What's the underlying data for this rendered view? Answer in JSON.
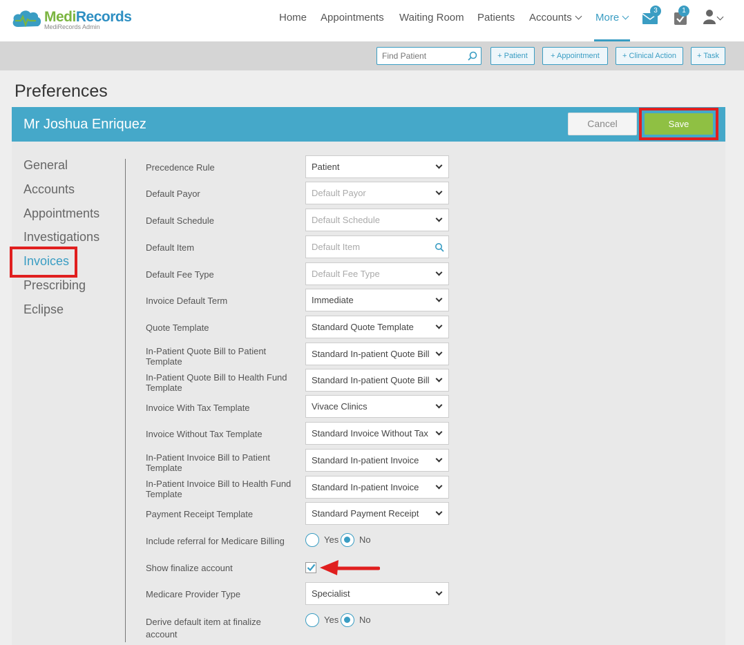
{
  "brand": {
    "name_part1": "Medi",
    "name_part2": "Records",
    "subtitle": "MediRecords Admin"
  },
  "nav": {
    "items": [
      {
        "label": "Home"
      },
      {
        "label": "Appointments"
      },
      {
        "label": "Waiting Room"
      },
      {
        "label": "Patients"
      },
      {
        "label": "Accounts"
      },
      {
        "label": "More"
      }
    ],
    "messages_count": "3",
    "tasks_count": "1"
  },
  "actionbar": {
    "find_placeholder": "Find Patient",
    "add_patient": "+ Patient",
    "add_appointment": "+ Appointment",
    "add_clinical_action": "+ Clinical Action",
    "add_task": "+ Task"
  },
  "page": {
    "title": "Preferences",
    "patient_name": "Mr Joshua Enriquez",
    "cancel_label": "Cancel",
    "save_label": "Save"
  },
  "sidebar": {
    "items": [
      {
        "label": "General"
      },
      {
        "label": "Accounts"
      },
      {
        "label": "Appointments"
      },
      {
        "label": "Investigations"
      },
      {
        "label": "Invoices"
      },
      {
        "label": "Prescribing"
      },
      {
        "label": "Eclipse"
      }
    ],
    "active": "Invoices"
  },
  "form": {
    "precedence_rule": {
      "label": "Precedence Rule",
      "value": "Patient"
    },
    "default_payor": {
      "label": "Default Payor",
      "placeholder": "Default Payor"
    },
    "default_schedule": {
      "label": "Default Schedule",
      "placeholder": "Default Schedule"
    },
    "default_item": {
      "label": "Default Item",
      "placeholder": "Default Item"
    },
    "default_fee_type": {
      "label": "Default Fee Type",
      "placeholder": "Default Fee Type"
    },
    "invoice_default_term": {
      "label": "Invoice Default Term",
      "value": "Immediate"
    },
    "quote_template": {
      "label": "Quote Template",
      "value": "Standard Quote Template"
    },
    "inpatient_quote_patient": {
      "label": "In-Patient Quote Bill to Patient Template",
      "value": "Standard In-patient Quote Bill"
    },
    "inpatient_quote_fund": {
      "label": "In-Patient Quote Bill to Health Fund Template",
      "value": "Standard In-patient Quote Bill"
    },
    "invoice_with_tax": {
      "label": "Invoice With Tax Template",
      "value": "Vivace Clinics"
    },
    "invoice_without_tax": {
      "label": "Invoice Without Tax Template",
      "value": "Standard Invoice Without Tax"
    },
    "inpatient_invoice_patient": {
      "label": "In-Patient Invoice Bill to Patient Template",
      "value": "Standard In-patient Invoice"
    },
    "inpatient_invoice_fund": {
      "label": "In-Patient Invoice Bill to Health Fund Template",
      "value": "Standard In-patient Invoice"
    },
    "payment_receipt": {
      "label": "Payment Receipt Template",
      "value": "Standard Payment Receipt"
    },
    "include_referral": {
      "label": "Include referral for Medicare Billing",
      "yes": "Yes",
      "no": "No",
      "selected": "No"
    },
    "show_finalize": {
      "label": "Show finalize account",
      "checked": true
    },
    "medicare_provider_type": {
      "label": "Medicare Provider Type",
      "value": "Specialist"
    },
    "derive_default_item": {
      "label": "Derive default item at finalize account",
      "yes": "Yes",
      "no": "No",
      "selected": "No"
    }
  }
}
